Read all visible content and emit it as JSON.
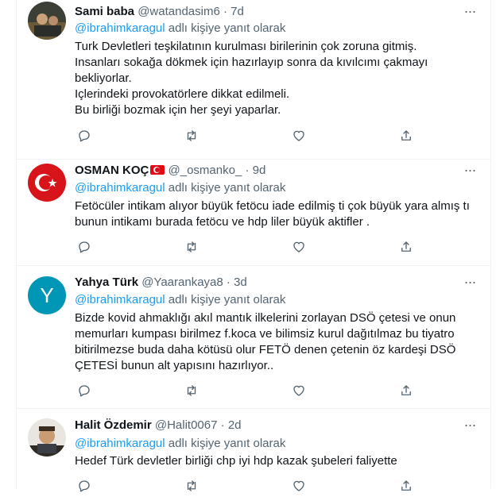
{
  "reply_prefix_suffix": "adlı kişiye yanıt olarak",
  "tweets": [
    {
      "name": "Sami baba",
      "handle": "@watandasim6",
      "dot": "·",
      "time": "7d",
      "mention": "@ibrahimkaragul",
      "lines": [
        "Turk Devletleri teşkilatının kurulması birilerinin çok zoruna gitmiş.",
        "Insanları sokağa dökmek için hazırlayıp sonra da kıvılcımı çakmayı",
        "bekliyorlar.",
        "Içlerindeki provokatörlere dikkat edilmeli.",
        "Bu birliği bozmak için her şeyi yaparlar."
      ]
    },
    {
      "name": "OSMAN KOÇ",
      "handle": "@_osmanko_",
      "dot": "·",
      "time": "9d",
      "mention": "@ibrahimkaragul",
      "lines": [
        "Fetöcüler intikam alıyor büyük fetöcu iade edilmiş ti çok büyük yara almış tı",
        "bunun intikamı burada fetöcu ve hdp liler büyük aktifler ."
      ]
    },
    {
      "name": "Yahya Türk",
      "handle": "@Yaarankaya8",
      "dot": "·",
      "time": "3d",
      "avatar_letter": "Y",
      "mention": "@ibrahimkaragul",
      "lines": [
        "Bizde kovid ahmaklığı  akıl mantık ilkelerini zorlayan DSÖ çetesi  ve onun",
        "memurları kumpası  birilmez f.koca ve bilimsiz kurul dağıtılmaz bu tiyatro",
        "bitirilmezse  buda daha kötüsü olur FETÖ denen çetenin öz kardeşi DSÖ",
        "ÇETESİ bunun alt yapısını hazırlıyor.."
      ]
    },
    {
      "name": "Halit Özdemir",
      "handle": "@Halit0067",
      "dot": "·",
      "time": "2d",
      "mention": "@ibrahimkaragul",
      "lines": [
        "Hedef Türk devletler birliği chp iyi hdp kazak şubeleri faliyette"
      ]
    }
  ]
}
